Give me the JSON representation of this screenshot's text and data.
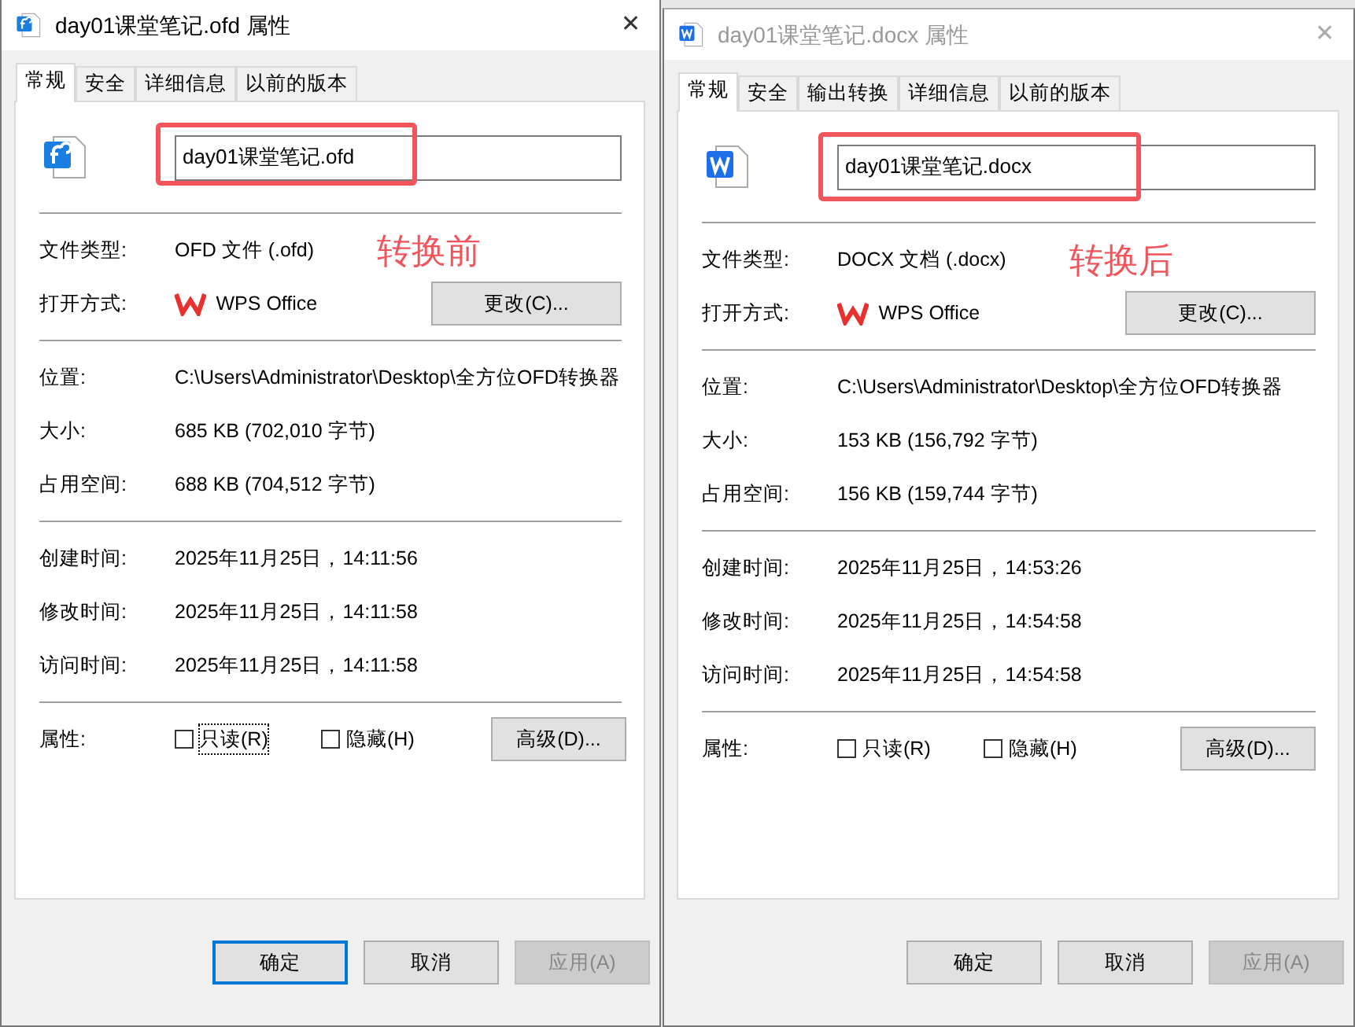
{
  "windows": [
    {
      "title": "day01课堂笔记.ofd 属性",
      "active": true,
      "kind": "ofd",
      "close": "✕",
      "tabs": [
        {
          "label": "常规",
          "selected": true
        },
        {
          "label": "安全",
          "selected": false
        },
        {
          "label": "详细信息",
          "selected": false
        },
        {
          "label": "以前的版本",
          "selected": false
        }
      ],
      "file_name": "day01课堂笔记.ofd",
      "annotation": "转换前",
      "file_type": {
        "label": "文件类型:",
        "value": "OFD 文件 (.ofd)"
      },
      "open_with": {
        "label": "打开方式:",
        "app": "WPS Office",
        "button": "更改(C)..."
      },
      "info_groups": [
        [
          {
            "label": "位置:",
            "value": "C:\\Users\\Administrator\\Desktop\\全方位OFD转换器"
          },
          {
            "label": "大小:",
            "value": "685 KB (702,010 字节)"
          },
          {
            "label": "占用空间:",
            "value": "688 KB (704,512 字节)"
          }
        ],
        [
          {
            "label": "创建时间:",
            "value": "2025年11月25日，14:11:56"
          },
          {
            "label": "修改时间:",
            "value": "2025年11月25日，14:11:58"
          },
          {
            "label": "访问时间:",
            "value": "2025年11月25日，14:11:58"
          }
        ]
      ],
      "attributes": {
        "label": "属性:",
        "checkboxes": [
          {
            "label": "只读(R)",
            "checked": false,
            "focused": true
          },
          {
            "label": "隐藏(H)",
            "checked": false,
            "focused": false
          }
        ],
        "button": "高级(D)..."
      },
      "buttons": [
        {
          "label": "确定",
          "default": true,
          "disabled": false
        },
        {
          "label": "取消",
          "default": false,
          "disabled": false
        },
        {
          "label": "应用(A)",
          "default": false,
          "disabled": true
        }
      ]
    },
    {
      "title": "day01课堂笔记.docx 属性",
      "active": false,
      "kind": "docx",
      "close": "✕",
      "tabs": [
        {
          "label": "常规",
          "selected": true
        },
        {
          "label": "安全",
          "selected": false
        },
        {
          "label": "输出转换",
          "selected": false
        },
        {
          "label": "详细信息",
          "selected": false
        },
        {
          "label": "以前的版本",
          "selected": false
        }
      ],
      "file_name": "day01课堂笔记.docx",
      "annotation": "转换后",
      "file_type": {
        "label": "文件类型:",
        "value": "DOCX 文档 (.docx)"
      },
      "open_with": {
        "label": "打开方式:",
        "app": "WPS Office",
        "button": "更改(C)..."
      },
      "info_groups": [
        [
          {
            "label": "位置:",
            "value": "C:\\Users\\Administrator\\Desktop\\全方位OFD转换器"
          },
          {
            "label": "大小:",
            "value": "153 KB (156,792 字节)"
          },
          {
            "label": "占用空间:",
            "value": "156 KB (159,744 字节)"
          }
        ],
        [
          {
            "label": "创建时间:",
            "value": "2025年11月25日，14:53:26"
          },
          {
            "label": "修改时间:",
            "value": "2025年11月25日，14:54:58"
          },
          {
            "label": "访问时间:",
            "value": "2025年11月25日，14:54:58"
          }
        ]
      ],
      "attributes": {
        "label": "属性:",
        "checkboxes": [
          {
            "label": "只读(R)",
            "checked": false,
            "focused": false
          },
          {
            "label": "隐藏(H)",
            "checked": false,
            "focused": false
          }
        ],
        "button": "高级(D)..."
      },
      "buttons": [
        {
          "label": "确定",
          "default": false,
          "disabled": false
        },
        {
          "label": "取消",
          "default": false,
          "disabled": false
        },
        {
          "label": "应用(A)",
          "default": false,
          "disabled": true
        }
      ]
    }
  ]
}
